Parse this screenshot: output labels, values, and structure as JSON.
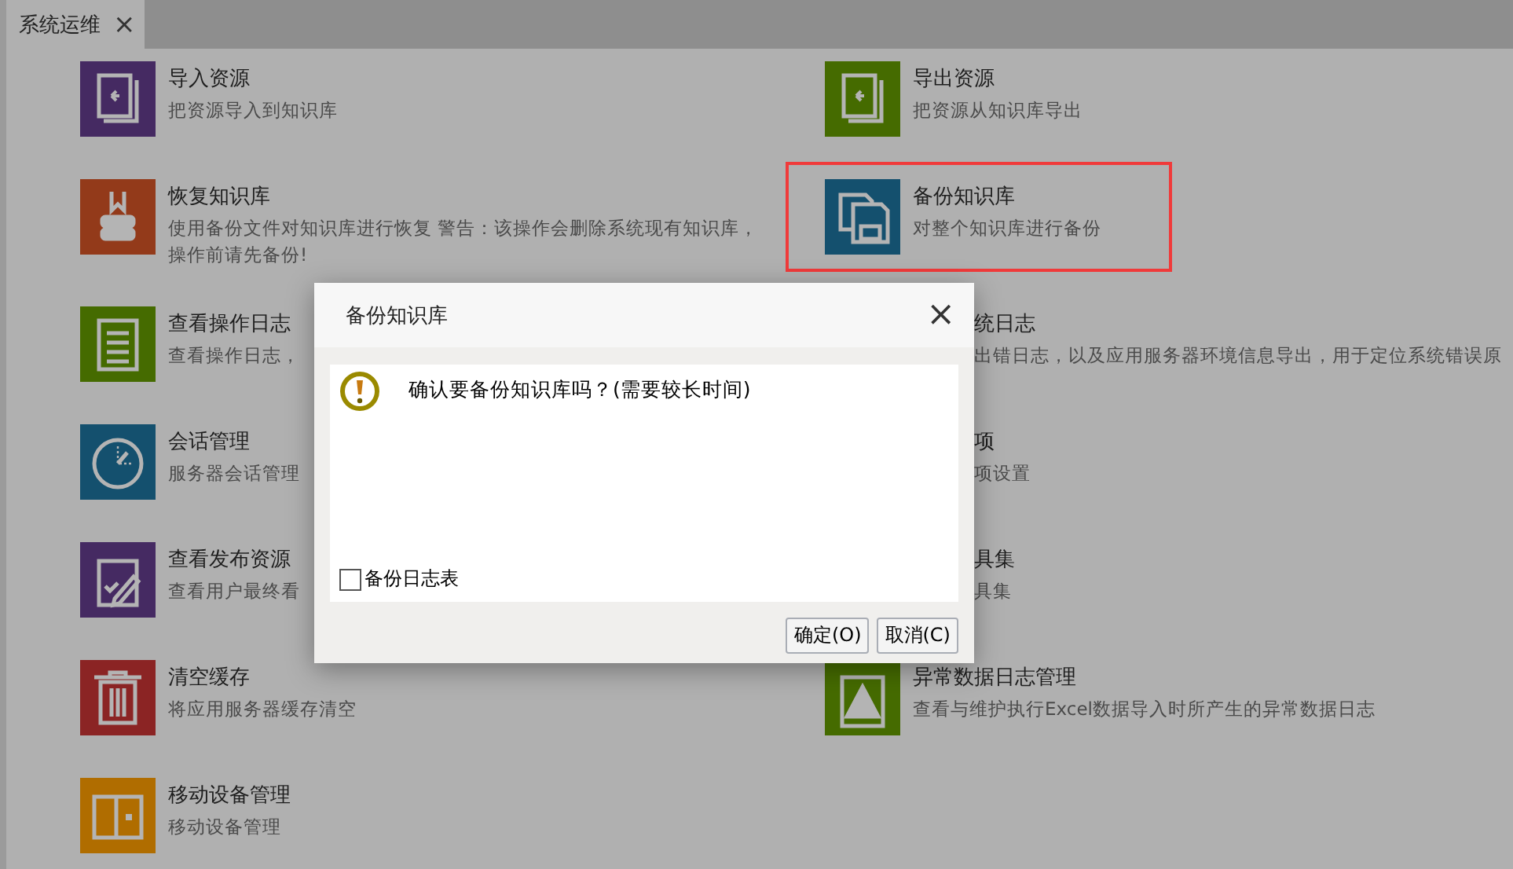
{
  "tabs": [
    {
      "label": "系统运维",
      "close": "×",
      "selected": true
    }
  ],
  "tiles": [
    {
      "title": "导入资源",
      "description": "把资源导入到知识库",
      "kind": "import",
      "highlighted": false
    },
    {
      "title": "导出资源",
      "description": "把资源从知识库导出",
      "kind": "export",
      "highlighted": false
    },
    {
      "title": "恢复知识库",
      "description": "使用备份文件对知识库进行恢复 警告：该操作会删除系统现有知识库，操作前请先备份!",
      "kind": "restore",
      "highlighted": false
    },
    {
      "title": "备份知识库",
      "description": "对整个知识库进行备份",
      "kind": "floppy",
      "highlighted": true
    },
    {
      "title": "查看操作日志",
      "description": "查看操作日志，",
      "kind": "log",
      "highlighted": false
    },
    {
      "title": "统日志",
      "description": "出错日志，以及应用服务器环境信息导出，用于定位系统错误原",
      "highlighted": false
    },
    {
      "title": "会话管理",
      "description": "服务器会话管理",
      "kind": "gauge",
      "highlighted": false
    },
    {
      "title": "项",
      "description": "项设置",
      "highlighted": false
    },
    {
      "title": "查看发布资源",
      "description": "查看用户最终看",
      "kind": "edit",
      "highlighted": false
    },
    {
      "title": "具集",
      "description": "具集",
      "highlighted": false
    },
    {
      "title": "清空缓存",
      "description": "将应用服务器缓存清空",
      "kind": "trash",
      "highlighted": false
    },
    {
      "title": "异常数据日志管理",
      "description": "查看与维护执行Excel数据导入时所产生的异常数据日志",
      "kind": "warning",
      "highlighted": false
    },
    {
      "title": "移动设备管理",
      "description": "移动设备管理",
      "kind": "mobile",
      "highlighted": false
    }
  ],
  "dialog": {
    "title": "备份知识库",
    "close": "×",
    "message": "确认要备份知识库吗？(需要较长时间)",
    "checkbox": {
      "label": "备份日志表",
      "checked": false
    },
    "buttons": [
      "确定(O)",
      "取消(C)"
    ]
  }
}
